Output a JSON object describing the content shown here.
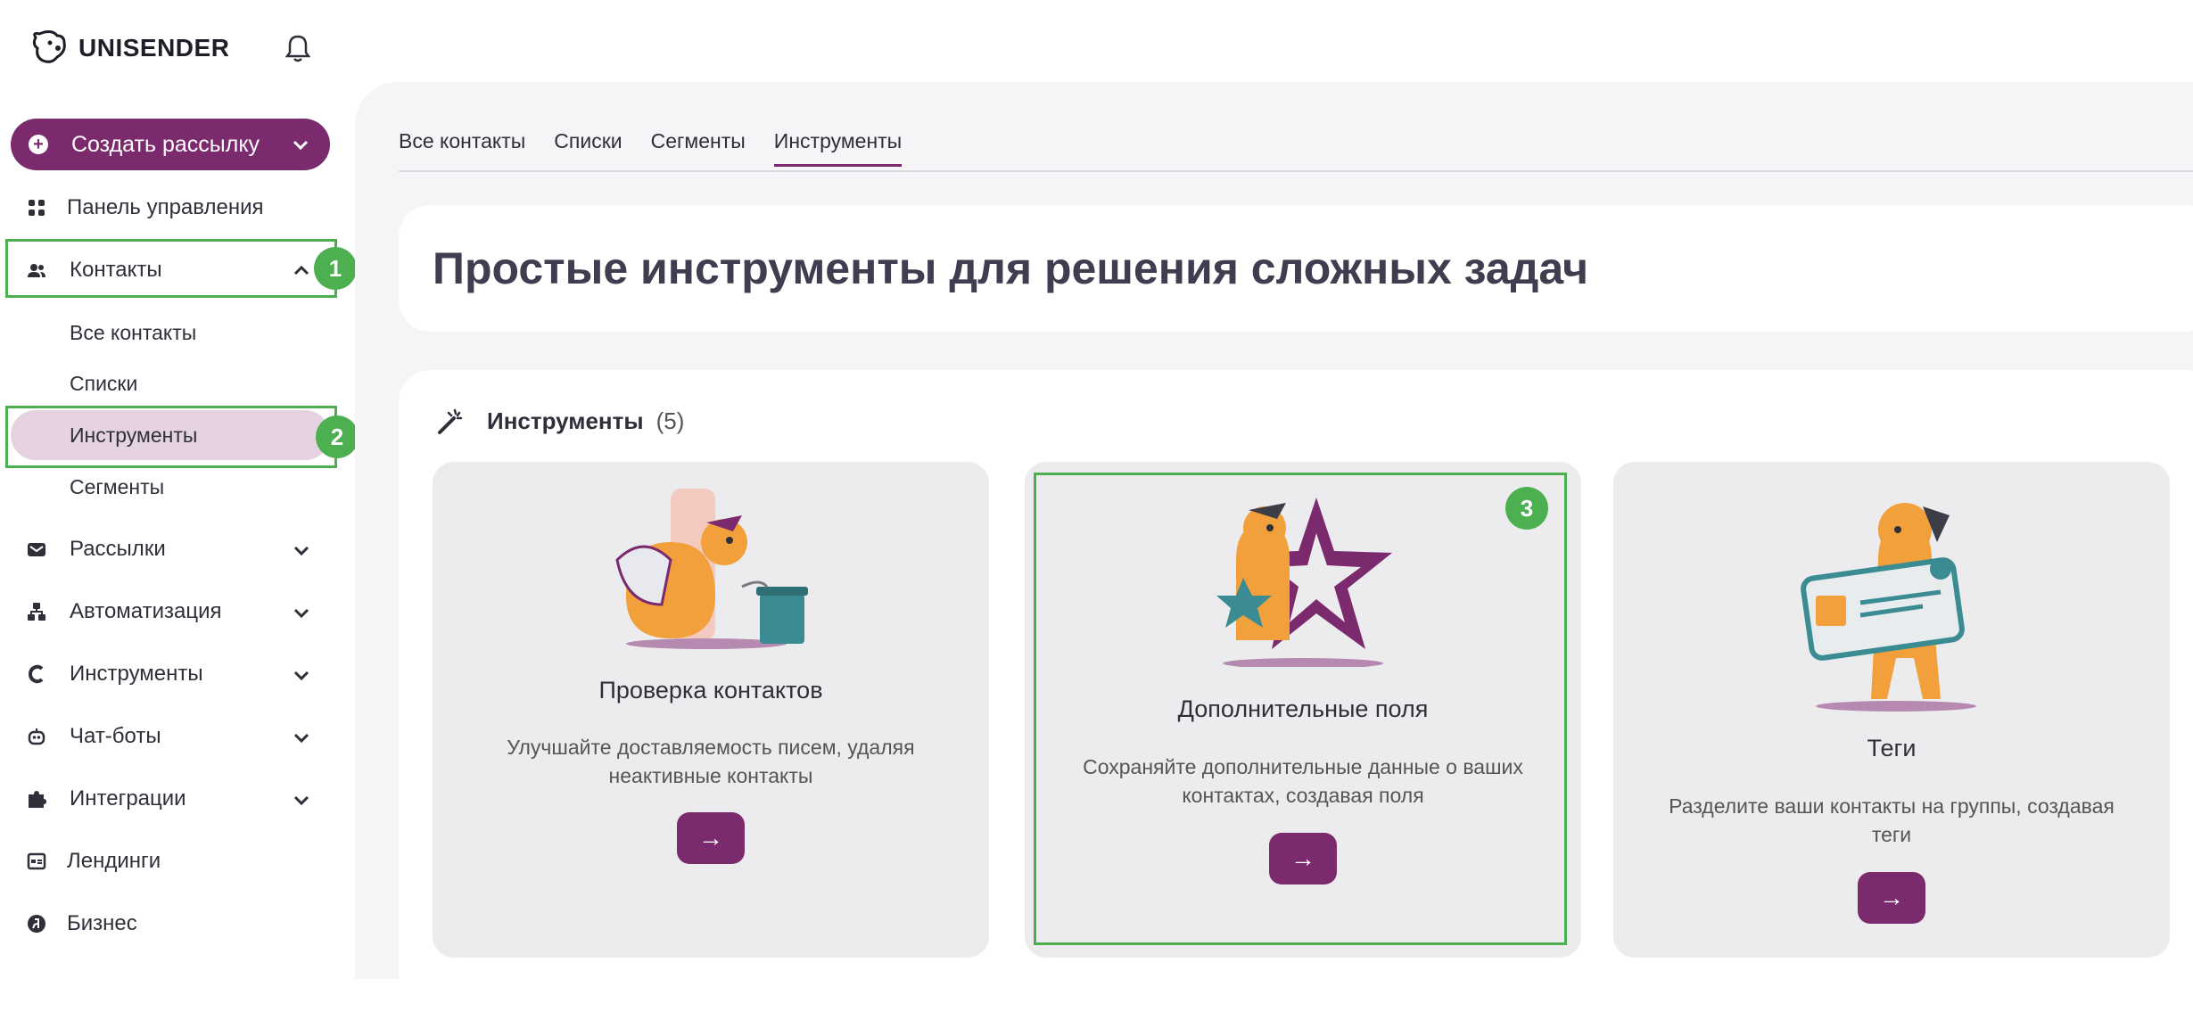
{
  "app": {
    "brand": "UNISENDER"
  },
  "sidebar": {
    "create_label": "Создать рассылку",
    "items": [
      {
        "label": "Панель управления",
        "icon": "dashboard-icon"
      },
      {
        "label": "Контакты",
        "icon": "contacts-icon"
      },
      {
        "label": "Рассылки",
        "icon": "mail-icon"
      },
      {
        "label": "Автоматизация",
        "icon": "automation-icon"
      },
      {
        "label": "Инструменты",
        "icon": "tools-icon"
      },
      {
        "label": "Чат-боты",
        "icon": "bot-icon"
      },
      {
        "label": "Интеграции",
        "icon": "puzzle-icon"
      },
      {
        "label": "Лендинги",
        "icon": "landing-icon"
      },
      {
        "label": "Бизнес",
        "icon": "business-icon"
      }
    ],
    "contacts_sub": [
      "Все контакты",
      "Списки",
      "Инструменты",
      "Сегменты"
    ]
  },
  "annotations": {
    "badge1": "1",
    "badge2": "2",
    "badge3": "3"
  },
  "tabs": [
    "Все контакты",
    "Списки",
    "Сегменты",
    "Инструменты"
  ],
  "hero": {
    "title": "Простые инструменты для решения сложных задач"
  },
  "tools": {
    "title": "Инструменты",
    "count": "(5)",
    "cards": [
      {
        "title": "Проверка контактов",
        "desc": "Улучшайте доставляемость писем, удаляя неактивные контакты",
        "button": "→"
      },
      {
        "title": "Дополнительные поля",
        "desc": "Сохраняйте дополнительные данные о ваших контактах, создавая поля",
        "button": "→"
      },
      {
        "title": "Теги",
        "desc": "Разделите ваши контакты на группы, создавая теги",
        "button": "→"
      }
    ]
  },
  "colors": {
    "accent": "#7b2a6e",
    "highlight": "#4caf50",
    "active_bg": "#e5d3e2"
  }
}
